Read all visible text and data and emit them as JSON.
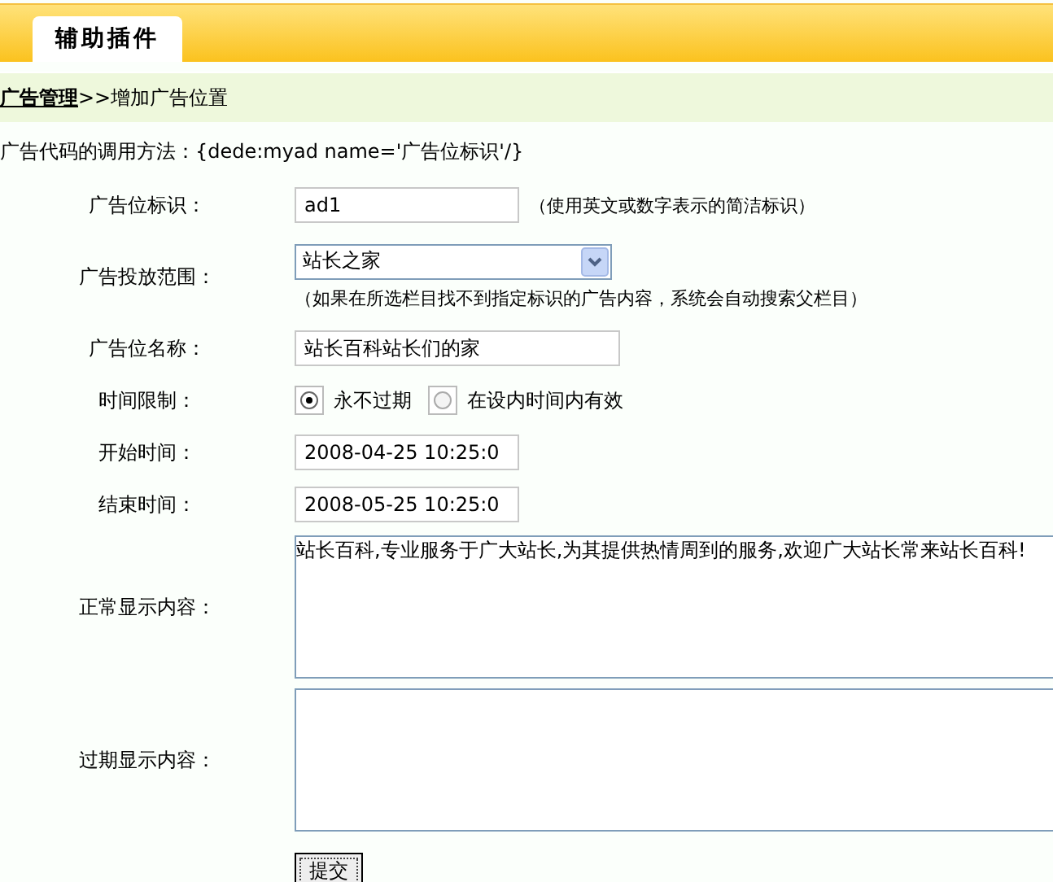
{
  "header": {
    "tab": "辅助插件"
  },
  "breadcrumb": {
    "link": "广告管理",
    "separator": ">>",
    "current": "增加广告位置"
  },
  "usage": "广告代码的调用方法：{dede:myad name='广告位标识'/}",
  "form": {
    "rows": [
      {
        "kind": "text",
        "label": "广告位标识：",
        "value": "ad1",
        "hint": "（使用英文或数字表示的简洁标识）"
      },
      {
        "kind": "select",
        "label": "广告投放范围：",
        "value": "站长之家",
        "hint": "（如果在所选栏目找不到指定标识的广告内容，系统会自动搜索父栏目）"
      },
      {
        "kind": "widetext",
        "label": "广告位名称：",
        "value": "站长百科站长们的家"
      },
      {
        "kind": "radio",
        "label": "时间限制：",
        "options": [
          {
            "label": "永不过期",
            "selected": true
          },
          {
            "label": "在设内时间内有效",
            "selected": false
          }
        ]
      },
      {
        "kind": "text",
        "label": "开始时间：",
        "value": "2008-04-25 10:25:0"
      },
      {
        "kind": "text",
        "label": "结束时间：",
        "value": "2008-05-25 10:25:0"
      },
      {
        "kind": "textarea",
        "label": "正常显示内容：",
        "value": "站长百科,专业服务于广大站长,为其提供热情周到的服务,欢迎广大站长常来站长百科!"
      },
      {
        "kind": "textarea",
        "label": "过期显示内容："
      }
    ]
  },
  "submit": "提交"
}
